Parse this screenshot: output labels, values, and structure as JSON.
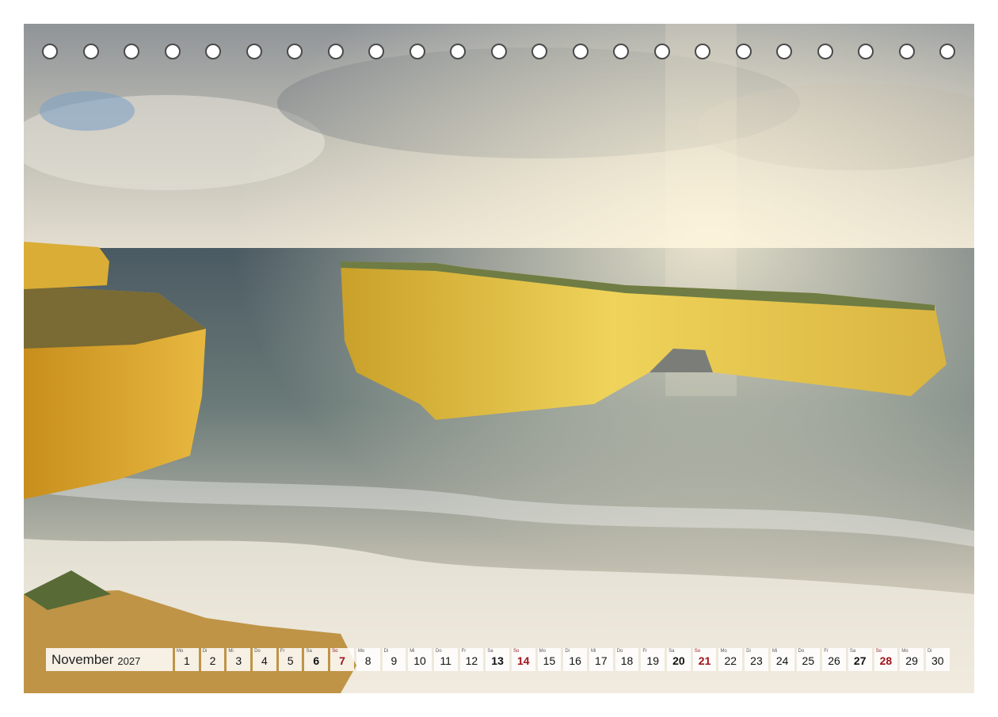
{
  "calendar": {
    "month": "November",
    "year": "2027",
    "days": [
      {
        "wd": "Mo",
        "d": "1",
        "t": "wk"
      },
      {
        "wd": "Di",
        "d": "2",
        "t": "wk"
      },
      {
        "wd": "Mi",
        "d": "3",
        "t": "wk"
      },
      {
        "wd": "Do",
        "d": "4",
        "t": "wk"
      },
      {
        "wd": "Fr",
        "d": "5",
        "t": "wk"
      },
      {
        "wd": "Sa",
        "d": "6",
        "t": "sat"
      },
      {
        "wd": "So",
        "d": "7",
        "t": "sun"
      },
      {
        "wd": "Mo",
        "d": "8",
        "t": "wk"
      },
      {
        "wd": "Di",
        "d": "9",
        "t": "wk"
      },
      {
        "wd": "Mi",
        "d": "10",
        "t": "wk"
      },
      {
        "wd": "Do",
        "d": "11",
        "t": "wk"
      },
      {
        "wd": "Fr",
        "d": "12",
        "t": "wk"
      },
      {
        "wd": "Sa",
        "d": "13",
        "t": "sat"
      },
      {
        "wd": "So",
        "d": "14",
        "t": "sun"
      },
      {
        "wd": "Mo",
        "d": "15",
        "t": "wk"
      },
      {
        "wd": "Di",
        "d": "16",
        "t": "wk"
      },
      {
        "wd": "Mi",
        "d": "17",
        "t": "wk"
      },
      {
        "wd": "Do",
        "d": "18",
        "t": "wk"
      },
      {
        "wd": "Fr",
        "d": "19",
        "t": "wk"
      },
      {
        "wd": "Sa",
        "d": "20",
        "t": "sat"
      },
      {
        "wd": "So",
        "d": "21",
        "t": "sun"
      },
      {
        "wd": "Mo",
        "d": "22",
        "t": "wk"
      },
      {
        "wd": "Di",
        "d": "23",
        "t": "wk"
      },
      {
        "wd": "Mi",
        "d": "24",
        "t": "wk"
      },
      {
        "wd": "Do",
        "d": "25",
        "t": "wk"
      },
      {
        "wd": "Fr",
        "d": "26",
        "t": "wk"
      },
      {
        "wd": "Sa",
        "d": "27",
        "t": "sat"
      },
      {
        "wd": "So",
        "d": "28",
        "t": "sun"
      },
      {
        "wd": "Mo",
        "d": "29",
        "t": "wk"
      },
      {
        "wd": "Di",
        "d": "30",
        "t": "wk"
      }
    ]
  },
  "colors": {
    "sunday": "#a0121a",
    "cliff": "#d8a832",
    "sea": "#5f6e70",
    "sky": "#c9c6bd"
  }
}
